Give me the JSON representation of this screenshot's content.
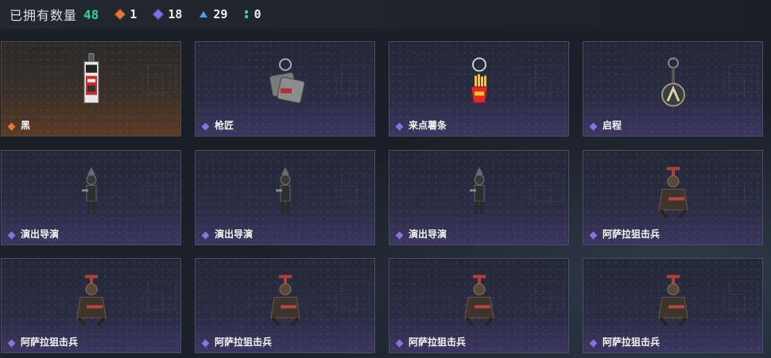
{
  "header": {
    "owned_label": "已拥有数量",
    "owned_count": "48",
    "stats": [
      {
        "icon": "orange-diamond-icon",
        "color": "#e07a3a",
        "value": "1"
      },
      {
        "icon": "purple-diamond-icon",
        "color": "#8a73e0",
        "value": "18"
      },
      {
        "icon": "blue-triangle-icon",
        "color": "#4aa3e8",
        "value": "29"
      },
      {
        "icon": "green-dots-icon",
        "color": "#2fd48f",
        "value": "0"
      }
    ]
  },
  "cards": [
    {
      "name": "黑",
      "rarity": "orange",
      "item": "black-tag-keychain"
    },
    {
      "name": "枪匠",
      "rarity": "purple",
      "item": "gunsmith-dogtag-keychain"
    },
    {
      "name": "来点薯条",
      "rarity": "purple",
      "item": "fries-keychain"
    },
    {
      "name": "启程",
      "rarity": "purple",
      "item": "medallion-keychain"
    },
    {
      "name": "演出导演",
      "rarity": "purple",
      "item": "director-figure-keychain"
    },
    {
      "name": "演出导演",
      "rarity": "purple",
      "item": "director-figure-keychain"
    },
    {
      "name": "演出导演",
      "rarity": "purple",
      "item": "director-figure-keychain"
    },
    {
      "name": "阿萨拉狙击兵",
      "rarity": "purple",
      "item": "sniper-figure-keychain"
    },
    {
      "name": "阿萨拉狙击兵",
      "rarity": "purple",
      "item": "sniper-figure-keychain"
    },
    {
      "name": "阿萨拉狙击兵",
      "rarity": "purple",
      "item": "sniper-figure-keychain"
    },
    {
      "name": "阿萨拉狙击兵",
      "rarity": "purple",
      "item": "sniper-figure-keychain"
    },
    {
      "name": "阿萨拉狙击兵",
      "rarity": "purple",
      "item": "sniper-figure-keychain"
    }
  ],
  "colors": {
    "owned_count": "#2fd48f",
    "purple_rarity": "#8a73e0",
    "orange_rarity": "#e07a3a"
  }
}
